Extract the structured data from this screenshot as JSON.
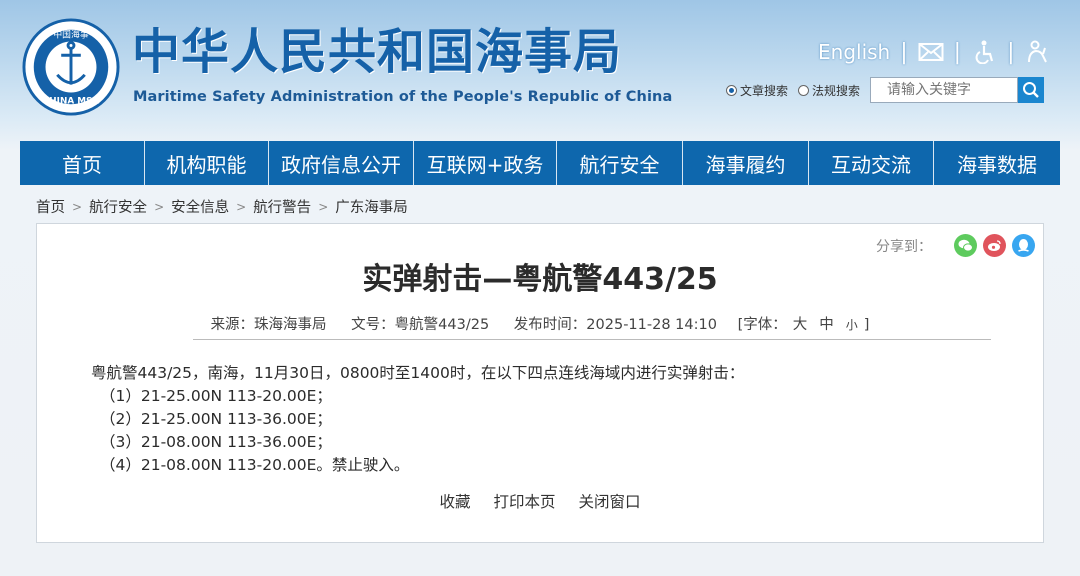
{
  "header": {
    "title": "中华人民共和国海事局",
    "subtitle": "Maritime Safety Administration of the People's Republic of China",
    "logo_text": "CHINA MSA",
    "logo_top_text": "中国海事",
    "english_link": "English",
    "icons": [
      "mail-icon",
      "accessibility-icon",
      "elder-care-icon"
    ]
  },
  "search": {
    "options": [
      "文章搜索",
      "法规搜索"
    ],
    "selected": "文章搜索",
    "placeholder": "请输入关键字"
  },
  "nav": {
    "items": [
      "首页",
      "机构职能",
      "政府信息公开",
      "互联网+政务",
      "航行安全",
      "海事履约",
      "互动交流",
      "海事数据"
    ]
  },
  "breadcrumb": [
    "首页",
    "航行安全",
    "安全信息",
    "航行警告",
    "广东海事局"
  ],
  "share": {
    "label": "分享到：",
    "targets": [
      "wechat-icon",
      "weibo-icon",
      "qq-icon"
    ]
  },
  "article": {
    "title": "实弹射击—粤航警443/25",
    "source": "来源：珠海海事局",
    "doc_no": "文号：粤航警443/25",
    "published": "发布时间：2025-11-28 14:10",
    "font_label": "[字体：",
    "font_large": "大",
    "font_medium": "中",
    "font_small": "小",
    "font_close": "]",
    "paragraph": "粤航警443/25，南海，11月30日，0800时至1400时，在以下四点连线海域内进行实弹射击：",
    "coords": [
      "（1）21-25.00N 113-20.00E；",
      "（2）21-25.00N 113-36.00E；",
      "（3）21-08.00N 113-36.00E；",
      "（4）21-08.00N 113-20.00E。禁止驶入。"
    ]
  },
  "actions": [
    "收藏",
    "打印本页",
    "关闭窗口"
  ],
  "colors": {
    "brand_blue": "#1561a8",
    "nav_bg": "#0e67ad",
    "search_btn": "#1a86cf",
    "wechat": "#5ecb5e",
    "weibo": "#e0545c",
    "qq": "#38a6f0"
  }
}
